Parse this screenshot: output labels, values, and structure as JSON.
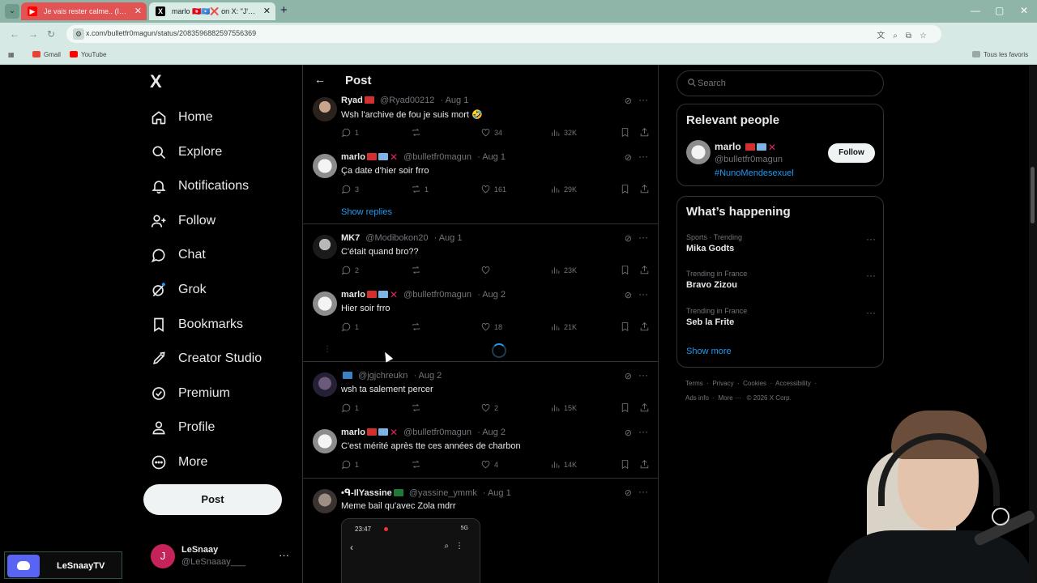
{
  "browser": {
    "tabs": [
      {
        "label": "Je vais rester calme.. (Infos Re...",
        "favicon": "youtube-icon"
      },
      {
        "label": "marlo 🇹🇳🇸🇴❌ on X: \"J'vous la...",
        "favicon": "x-icon"
      }
    ],
    "url": "x.com/bulletfr0magun/status/2083596882597556369",
    "bookmarks": [
      "Gmail",
      "YouTube"
    ],
    "bookmarks_right": "Tous les favoris"
  },
  "sidebar": {
    "logo": "X",
    "items": [
      {
        "label": "Home",
        "icon": "home-icon"
      },
      {
        "label": "Explore",
        "icon": "search-icon"
      },
      {
        "label": "Notifications",
        "icon": "bell-icon"
      },
      {
        "label": "Follow",
        "icon": "person-plus-icon"
      },
      {
        "label": "Chat",
        "icon": "chat-icon"
      },
      {
        "label": "Grok",
        "icon": "grok-icon"
      },
      {
        "label": "Bookmarks",
        "icon": "bookmark-icon"
      },
      {
        "label": "Creator Studio",
        "icon": "rocket-icon"
      },
      {
        "label": "Premium",
        "icon": "verified-icon"
      },
      {
        "label": "Profile",
        "icon": "person-icon"
      },
      {
        "label": "More",
        "icon": "more-circle-icon"
      }
    ],
    "post_button": "Post",
    "account": {
      "initial": "J",
      "name": "LeSnaay",
      "handle": "@LeSnaaay___"
    }
  },
  "header": {
    "title": "Post"
  },
  "tweets": [
    {
      "name": "Ryad",
      "handle": "@Ryad00212",
      "date": "· Aug 1",
      "text": "Wsh l'archive de fou je suis mort 🤣",
      "replies": "1",
      "retweets": "",
      "likes": "34",
      "views": "32K"
    },
    {
      "name": "marlo",
      "handle": "@bulletfr0magun",
      "date": "· Aug 1",
      "text": "Ça date d'hier soir frro",
      "replies": "3",
      "retweets": "1",
      "likes": "161",
      "views": "29K"
    },
    {
      "name": "MK7",
      "handle": "@Modibokon20",
      "date": "· Aug 1",
      "text": "C'était quand bro??",
      "replies": "2",
      "retweets": "",
      "likes": "",
      "views": "23K"
    },
    {
      "name": "marlo",
      "handle": "@bulletfr0magun",
      "date": "· Aug 2",
      "text": "Hier soir frro",
      "replies": "1",
      "retweets": "",
      "likes": "18",
      "views": "21K"
    },
    {
      "name": "",
      "handle": "@jgjchreukn",
      "date": "· Aug 2",
      "text": "wsh ta salement percer",
      "replies": "1",
      "retweets": "",
      "likes": "2",
      "views": "15K"
    },
    {
      "name": "marlo",
      "handle": "@bulletfr0magun",
      "date": "· Aug 2",
      "text": "C'est mérité après tte ces années de charbon",
      "replies": "1",
      "retweets": "",
      "likes": "4",
      "views": "14K"
    },
    {
      "name": "•ᑫ-IlYassine",
      "handle": "@yassine_ymmk",
      "date": "· Aug 1",
      "text": "Meme bail qu'avec Zola mdrr"
    }
  ],
  "show_replies": "Show replies",
  "media_preview": {
    "time": "23:47",
    "status": "5G"
  },
  "right": {
    "search_placeholder": "Search",
    "relevant": {
      "title": "Relevant people",
      "name": "marlo",
      "handle": "@bulletfr0magun",
      "bio": "#NunoMendesexuel",
      "follow": "Follow"
    },
    "happening": {
      "title": "What’s happening",
      "trends": [
        {
          "context": "Sports · Trending",
          "topic": "Mika Godts"
        },
        {
          "context": "Trending in France",
          "topic": "Bravo Zizou"
        },
        {
          "context": "Trending in France",
          "topic": "Seb la Frite"
        }
      ],
      "show_more": "Show more"
    },
    "footer": {
      "line1": [
        "Terms",
        "Privacy",
        "Cookies",
        "Accessibility"
      ],
      "line2": [
        "Ads info",
        "More ···",
        "© 2026 X Corp."
      ]
    }
  },
  "overlay": {
    "discord_name": "LeSnaayTV"
  }
}
